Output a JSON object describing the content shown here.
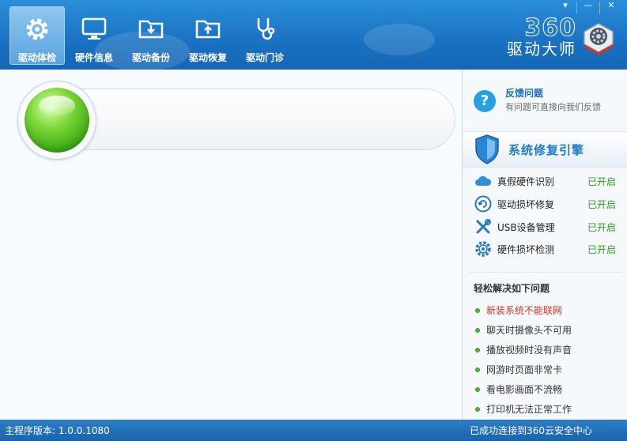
{
  "window": {
    "controls": {
      "menu": "▾",
      "minimize": "—",
      "close": "✕"
    }
  },
  "tabs": [
    {
      "label": "驱动体检",
      "icon": "gear-icon",
      "active": true
    },
    {
      "label": "硬件信息",
      "icon": "monitor-icon",
      "active": false
    },
    {
      "label": "驱动备份",
      "icon": "folder-download-icon",
      "active": false
    },
    {
      "label": "驱动恢复",
      "icon": "folder-upload-icon",
      "active": false
    },
    {
      "label": "驱动门诊",
      "icon": "stethoscope-icon",
      "active": false
    }
  ],
  "brand": {
    "number": "360",
    "name": "驱动大师",
    "logo": "360-drive-logo-icon"
  },
  "scan": {
    "indicator": "green-orb"
  },
  "side": {
    "feedback": {
      "title": "反馈问题",
      "subtitle": "有问题可直接向我们反馈",
      "icon": "question-icon"
    },
    "engine": {
      "title": "系统修复引擎",
      "icon": "shield-icon"
    },
    "features": [
      {
        "label": "真假硬件识别",
        "status": "已开启",
        "icon": "cloud-icon"
      },
      {
        "label": "驱动损坏修复",
        "status": "已开启",
        "icon": "repair-icon"
      },
      {
        "label": "USB设备管理",
        "status": "已开启",
        "icon": "tools-icon"
      },
      {
        "label": "硬件损坏检测",
        "status": "已开启",
        "icon": "gear-check-icon"
      }
    ],
    "easy_title": "轻松解决如下问题",
    "issues": [
      {
        "label": "新装系统不能联网",
        "highlight": true
      },
      {
        "label": "聊天时摄像头不可用",
        "highlight": false
      },
      {
        "label": "播放视频时没有声音",
        "highlight": false
      },
      {
        "label": "网游时页面非常卡",
        "highlight": false
      },
      {
        "label": "看电影画面不流畅",
        "highlight": false
      },
      {
        "label": "打印机无法正常工作",
        "highlight": false
      }
    ]
  },
  "footer": {
    "version": "主程序版本: 1.0.0.1080",
    "status": "已成功连接到360云安全中心"
  },
  "colors": {
    "header": "#1a72c2",
    "accent": "#27a0e0",
    "status_on": "#2f9a1e",
    "highlight": "#d2392a"
  }
}
